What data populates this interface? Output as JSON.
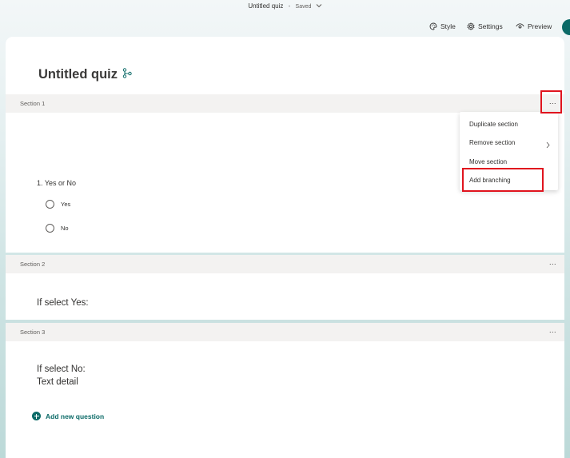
{
  "header": {
    "doc_title": "Untitled quiz",
    "separator": "-",
    "status": "Saved",
    "toolbar": {
      "style_label": "Style",
      "settings_label": "Settings",
      "preview_label": "Preview"
    }
  },
  "quiz": {
    "title": "Untitled quiz"
  },
  "sections": [
    {
      "label": "Section 1"
    },
    {
      "label": "Section 2"
    },
    {
      "label": "Section 3"
    }
  ],
  "section1": {
    "question": "1. Yes or No",
    "options": [
      "Yes",
      "No"
    ]
  },
  "section2": {
    "text": "If select Yes:"
  },
  "section3": {
    "line1": "If select No:",
    "line2": "Text detail"
  },
  "add_question_label": "Add new question",
  "more_label": "...",
  "menu": {
    "items": [
      "Duplicate section",
      "Remove section",
      "Move section",
      "Add branching"
    ]
  },
  "colors": {
    "accent": "#0b6a67",
    "highlight": "#e0141e",
    "section_bar": "#f3f2f1"
  }
}
